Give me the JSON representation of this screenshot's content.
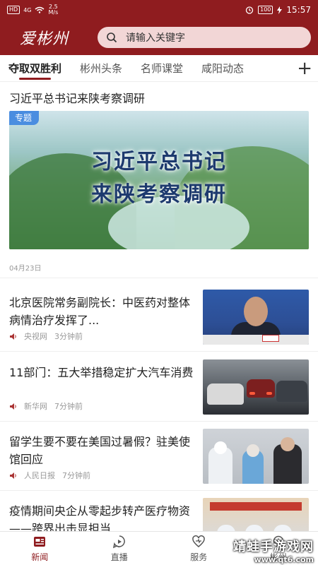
{
  "status_bar": {
    "hd": "HD",
    "signal": "4G",
    "speed": "2.5",
    "speed_unit": "M/s",
    "battery": "100",
    "time": "15:57"
  },
  "header": {
    "logo": "爱彬州",
    "search_placeholder": "请输入关键字"
  },
  "tabs": [
    "夺取双胜利",
    "彬州头条",
    "名师课堂",
    "咸阳动态"
  ],
  "featured": {
    "title": "习近平总书记来陕考察调研",
    "badge": "专题",
    "image_line1": "习近平总书记",
    "image_line2": "来陕考察调研",
    "date": "04月23日"
  },
  "news": [
    {
      "title": "北京医院常务副院长：中医药对整体病情治疗发挥了...",
      "source": "央视网",
      "time": "3分钟前"
    },
    {
      "title": "11部门：五大举措稳定扩大汽车消费",
      "source": "新华网",
      "time": "7分钟前"
    },
    {
      "title": "留学生要不要在美国过暑假？驻美使馆回应",
      "source": "人民日报",
      "time": "7分钟前"
    },
    {
      "title": "疫情期间央企从零起步转产医疗物资——跨界出击显担当",
      "source": "",
      "time": ""
    }
  ],
  "bottom_nav": [
    "新闻",
    "直播",
    "服务",
    "彬州"
  ],
  "watermark": {
    "big": "靖蛙手游戏网",
    "small": "www.qt6.com"
  },
  "colors": {
    "brand": "#8f1c1f",
    "search_bg": "#f2d6d6",
    "badge": "#4a8de0"
  }
}
